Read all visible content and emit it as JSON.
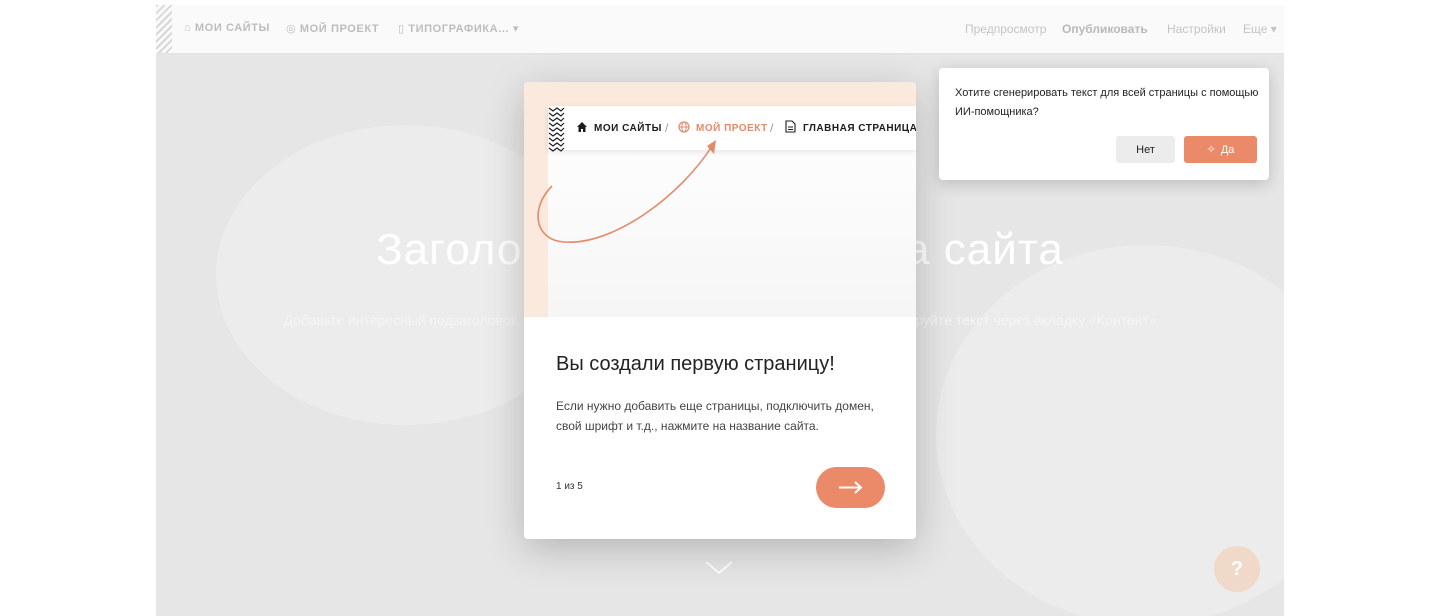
{
  "topbar": {
    "my_sites": "Мои сайты",
    "project": "Мой проект",
    "page": "Типографика...",
    "preview": "Предпросмотр",
    "publish": "Опубликовать",
    "settings": "Настройки",
    "more": "Еще"
  },
  "hero": {
    "title": "Заголовок первого экрана сайта",
    "subtitle": "Добавьте интересный подзаголовок, который раскроет суть и мотивирует к действию. Отредактируйте текст через вкладку «Контент»"
  },
  "help": {
    "label": "?"
  },
  "onboarding": {
    "breadcrumb": {
      "my_sites": "МОИ САЙТЫ",
      "separator": "/",
      "project": "МОЙ ПРОЕКТ",
      "page": "ГЛАВНАЯ СТРАНИЦА"
    },
    "title": "Вы создали первую страницу!",
    "text": "Если нужно добавить еще страницы, подключить домен, свой шрифт и т.д., нажмите на название сайта.",
    "step": "1 из 5",
    "accent": "#ea8a69"
  },
  "ai_prompt": {
    "question": "Хотите сгенерировать текст для всей страницы с помощью ИИ-помощника?",
    "no_label": "Нет",
    "yes_label": "Да"
  }
}
